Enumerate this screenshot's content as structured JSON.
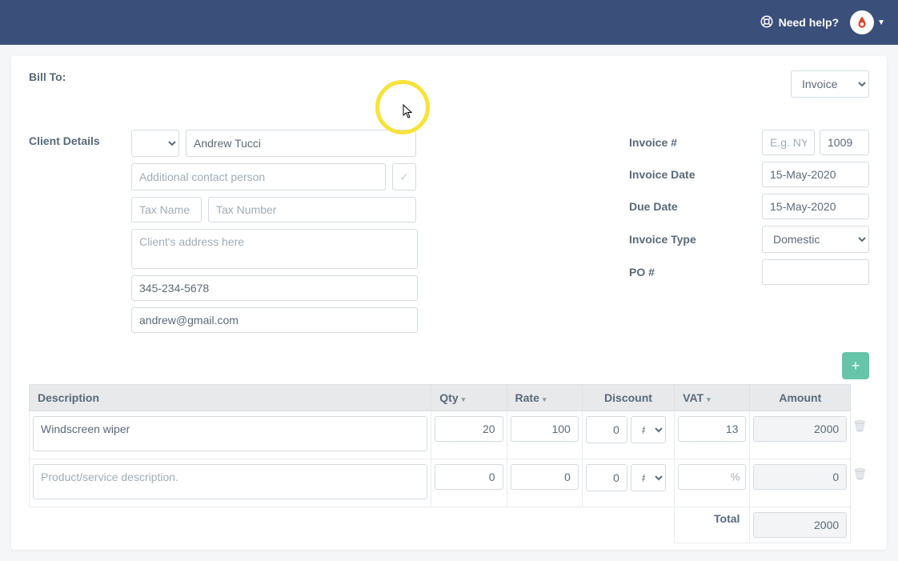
{
  "header": {
    "need_help": "Need help?"
  },
  "doc_type": "Invoice",
  "bill_to_label": "Bill To:",
  "client_details_label": "Client Details",
  "client": {
    "title": "",
    "name": "Andrew Tucci",
    "contact_person_placeholder": "Additional contact person",
    "tax_name_placeholder": "Tax Name",
    "tax_number_placeholder": "Tax Number",
    "address_placeholder": "Client's address here",
    "phone": "345-234-5678",
    "email": "andrew@gmail.com"
  },
  "meta": {
    "invoice_num_label": "Invoice #",
    "invoice_prefix_placeholder": "E.g. NYC",
    "invoice_num": "1009",
    "invoice_date_label": "Invoice Date",
    "invoice_date": "15-May-2020",
    "due_date_label": "Due Date",
    "due_date": "15-May-2020",
    "invoice_type_label": "Invoice Type",
    "invoice_type": "Domestic",
    "po_label": "PO #",
    "po": ""
  },
  "table": {
    "headers": {
      "description": "Description",
      "qty": "Qty",
      "rate": "Rate",
      "discount": "Discount",
      "vat": "VAT",
      "amount": "Amount"
    },
    "rows": [
      {
        "description": "Windscreen wiper",
        "qty": "20",
        "rate": "100",
        "discount": "0",
        "discount_type": "#",
        "vat": "13",
        "vat_unit": "",
        "amount": "2000"
      },
      {
        "description": "",
        "description_placeholder": "Product/service description.",
        "qty": "0",
        "rate": "0",
        "discount": "0",
        "discount_type": "#",
        "vat": "",
        "vat_unit": "%",
        "amount": "0"
      }
    ],
    "total_label": "Total",
    "total": "2000"
  }
}
